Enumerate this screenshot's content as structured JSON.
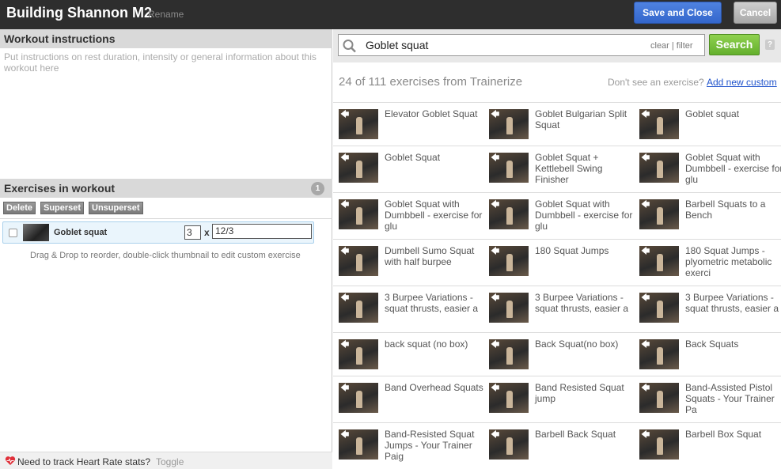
{
  "header": {
    "title": "Building Shannon M2",
    "rename_label": "Rename",
    "save_label": "Save and Close",
    "cancel_label": "Cancel"
  },
  "left": {
    "instructions_heading": "Workout instructions",
    "instructions_placeholder": "Put instructions on rest duration, intensity or general information about this workout here",
    "exercises_heading": "Exercises in workout",
    "exercise_count": "1",
    "delete_label": "Delete",
    "superset_label": "Superset",
    "unsuperset_label": "Unsuperset",
    "exercises": [
      {
        "name": "Goblet squat",
        "sets": "3",
        "times": "x",
        "reps": "12/3"
      }
    ],
    "dnd_hint": "Drag & Drop to reorder, double-click thumbnail to edit custom exercise",
    "footer_text": "Need to track Heart Rate stats?",
    "footer_toggle": "Toggle"
  },
  "right": {
    "search_value": "Goblet squat",
    "clear_filter": "clear | filter",
    "search_label": "Search",
    "help_label": "?",
    "results_count": "24 of 111 exercises from Trainerize",
    "missing_text": "Don't see an exercise?",
    "add_new_label": "Add new custom",
    "results": [
      [
        "Elevator Goblet Squat",
        "Goblet Bulgarian Split Squat",
        "Goblet squat"
      ],
      [
        "Goblet Squat",
        "Goblet Squat + Kettlebell Swing Finisher",
        "Goblet Squat with Dumbbell - exercise for glu"
      ],
      [
        "Goblet Squat with Dumbbell - exercise for glu",
        "Goblet Squat with Dumbbell - exercise for glu",
        "Barbell Squats to a Bench"
      ],
      [
        "Dumbell Sumo Squat with half burpee",
        "180 Squat Jumps",
        "180 Squat Jumps - plyometric metabolic exerci"
      ],
      [
        "3 Burpee Variations - squat thrusts, easier a",
        "3 Burpee Variations - squat thrusts, easier a",
        "3 Burpee Variations - squat thrusts, easier a"
      ],
      [
        "back squat (no box)",
        "Back Squat(no box)",
        "Back Squats"
      ],
      [
        "Band Overhead Squats",
        "Band Resisted Squat jump",
        "Band-Assisted Pistol Squats - Your Trainer Pa"
      ],
      [
        "Band-Resisted Squat Jumps - Your Trainer Paig",
        "Barbell Back Squat",
        "Barbell Box Squat"
      ]
    ]
  }
}
